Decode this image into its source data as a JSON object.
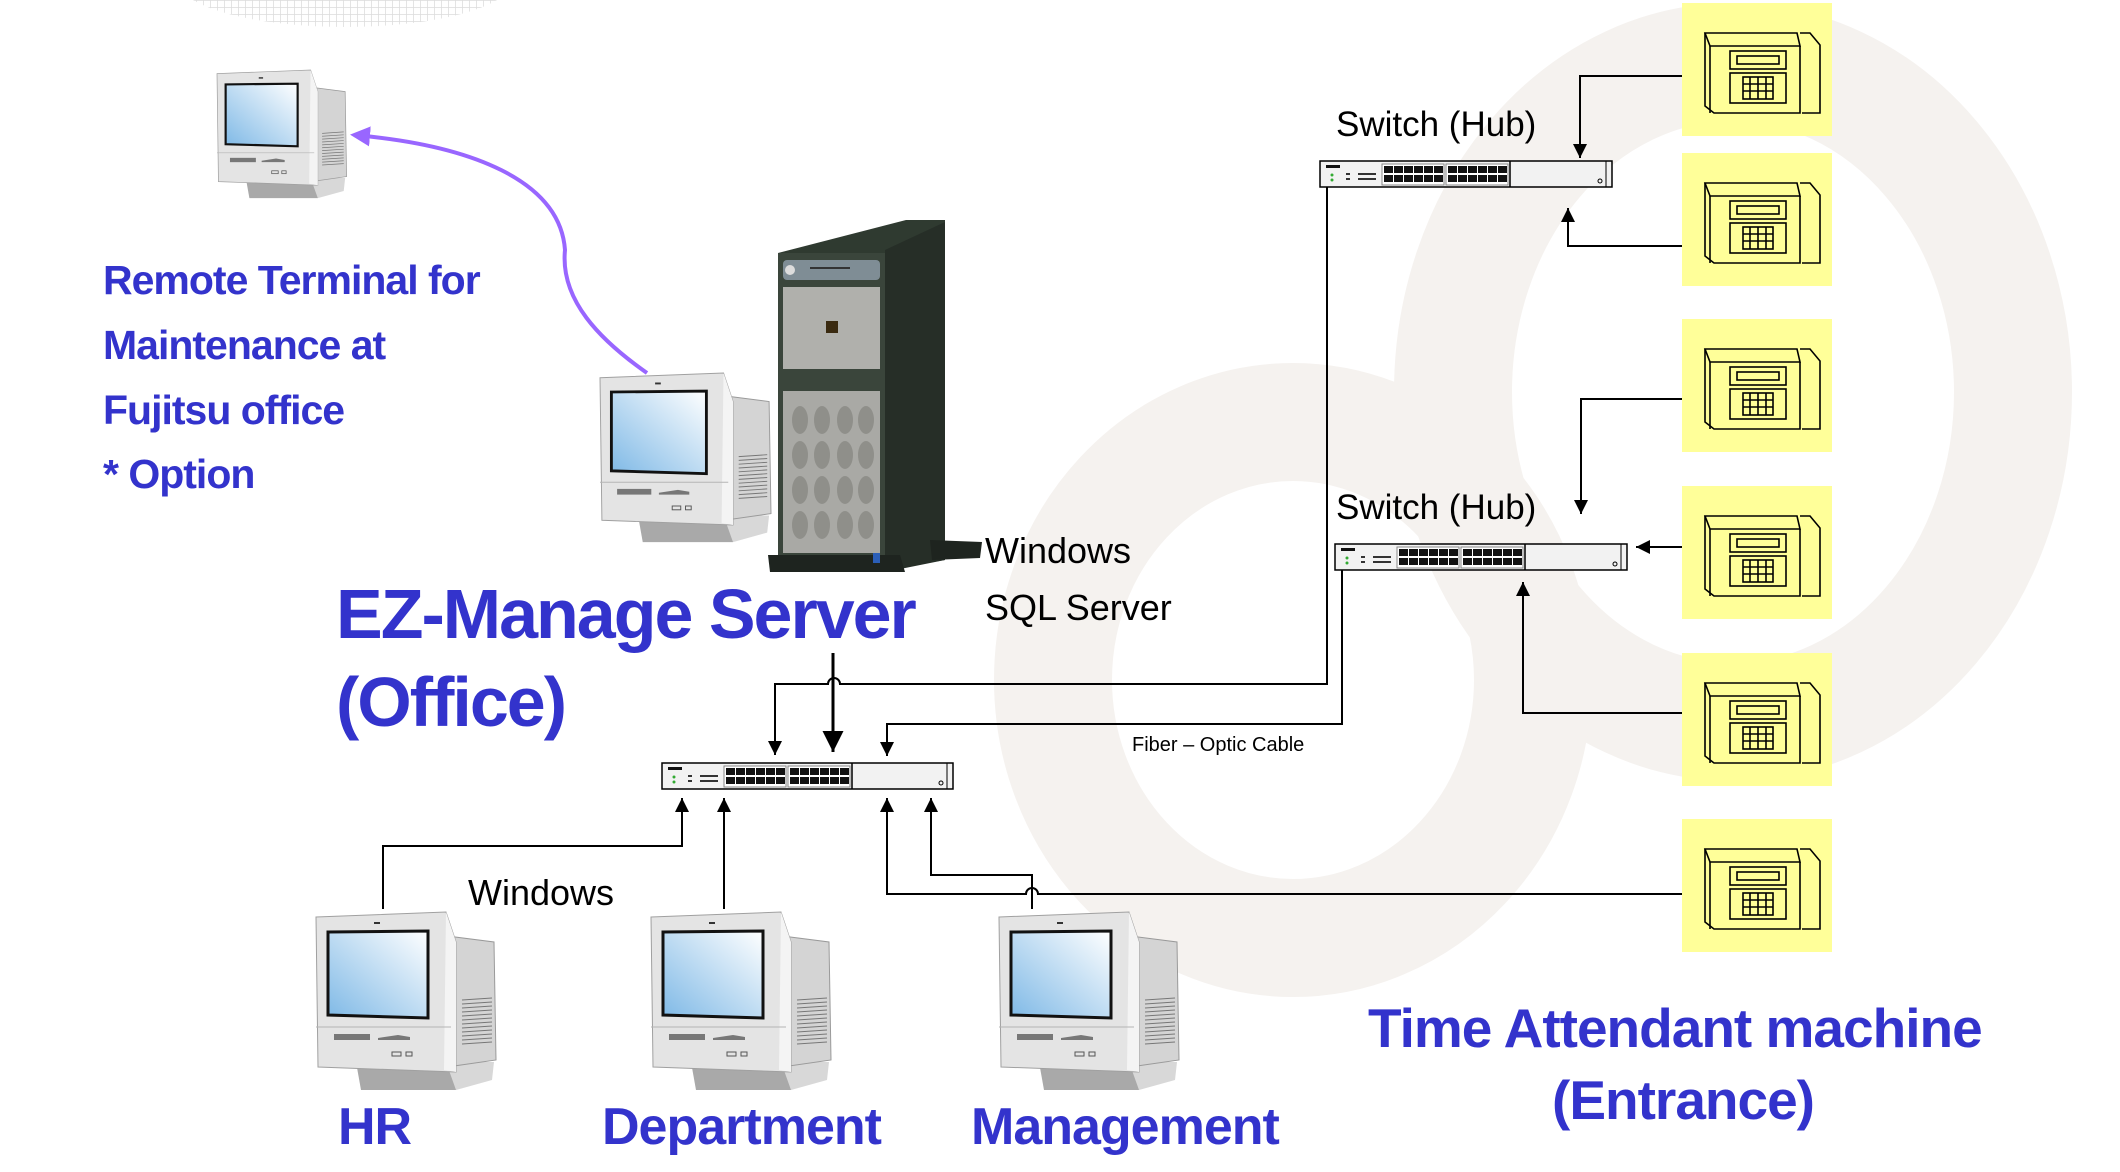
{
  "diagram": {
    "title": "EZ-Manage Server (Office)",
    "colors": {
      "label_blue": "#3333cc",
      "remote_link_purple": "#9966ff",
      "time_machine_bg": "#ffff99",
      "watermark": "#f5f2ef",
      "connector": "#000000"
    },
    "remote_terminal": {
      "icon": "desktop-computer-icon",
      "label_lines": [
        "Remote Terminal for",
        "Maintenance at",
        "Fujitsu office",
        "* Option"
      ]
    },
    "server": {
      "icon": "tower-server-icon",
      "console_icon": "desktop-computer-icon",
      "title_line1": "EZ-Manage Server",
      "title_line2": "(Office)",
      "software_lines": [
        "Windows",
        "SQL Server"
      ]
    },
    "switches": [
      {
        "id": "core-switch",
        "icon": "network-switch-icon",
        "label": ""
      },
      {
        "id": "switch-hub-1",
        "icon": "network-switch-icon",
        "label": "Switch (Hub)"
      },
      {
        "id": "switch-hub-2",
        "icon": "network-switch-icon",
        "label": "Switch (Hub)"
      }
    ],
    "cable_label": "Fiber – Optic Cable",
    "client_os_label": "Windows",
    "clients": [
      {
        "label": "HR",
        "icon": "desktop-computer-icon"
      },
      {
        "label": "Department",
        "icon": "desktop-computer-icon"
      },
      {
        "label": "Management",
        "icon": "desktop-computer-icon"
      }
    ],
    "time_machines": {
      "icon": "time-clock-terminal-icon",
      "count": 6,
      "label_line1": "Time Attendant machine",
      "label_line2": "(Entrance)"
    },
    "connections": [
      {
        "from": "remote_terminal",
        "to": "server",
        "style": "curved-arrow"
      },
      {
        "from": "server",
        "to": "core-switch"
      },
      {
        "from": "switch-hub-1",
        "to": "core-switch",
        "medium": "Fiber – Optic Cable"
      },
      {
        "from": "switch-hub-2",
        "to": "core-switch",
        "medium": "Fiber – Optic Cable"
      },
      {
        "from": "time-machine-1",
        "to": "switch-hub-1"
      },
      {
        "from": "time-machine-2",
        "to": "switch-hub-1"
      },
      {
        "from": "time-machine-3",
        "to": "switch-hub-2"
      },
      {
        "from": "time-machine-4",
        "to": "switch-hub-2"
      },
      {
        "from": "time-machine-5",
        "to": "switch-hub-2"
      },
      {
        "from": "time-machine-6",
        "to": "core-switch"
      },
      {
        "from": "HR",
        "to": "core-switch"
      },
      {
        "from": "Department",
        "to": "core-switch"
      },
      {
        "from": "Management",
        "to": "core-switch"
      }
    ]
  }
}
